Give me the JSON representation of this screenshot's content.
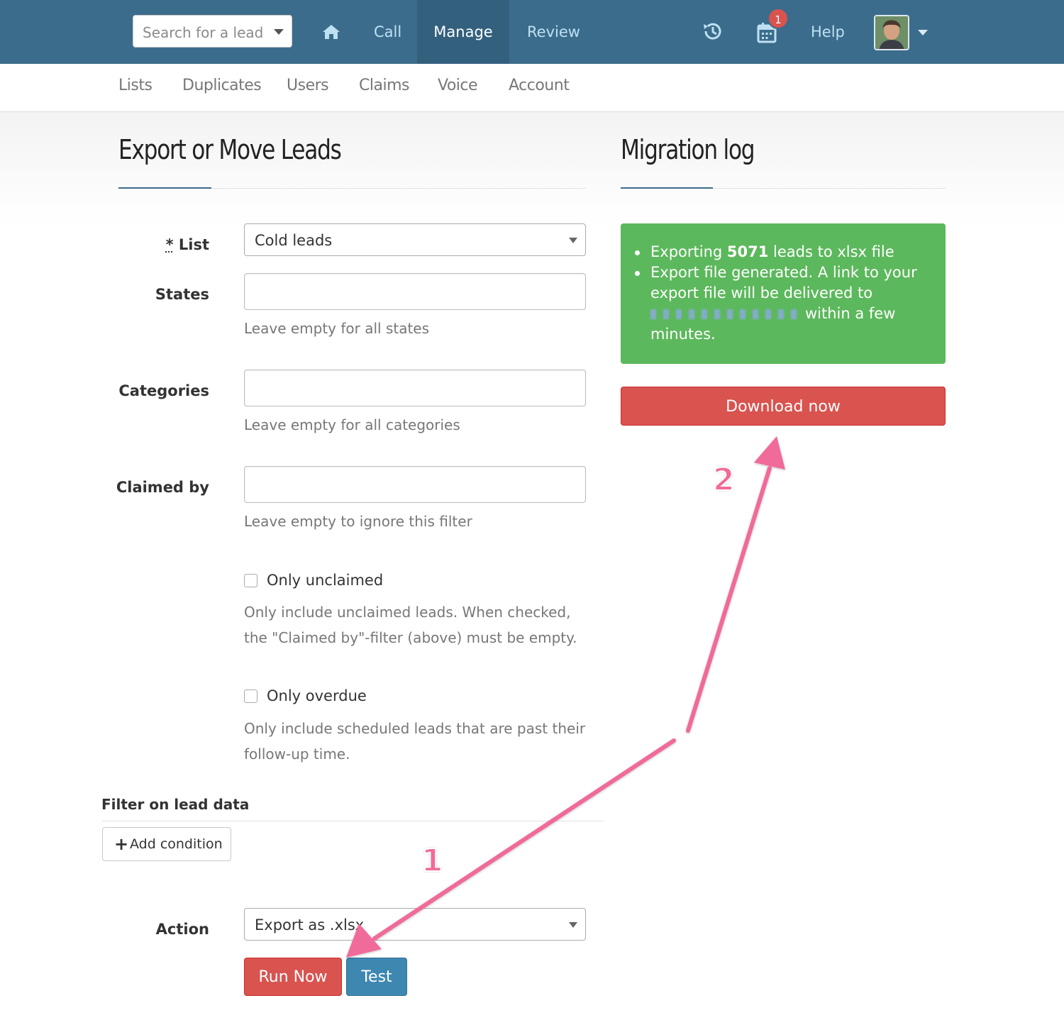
{
  "navbar": {
    "search_placeholder": "Search for a lead",
    "items": [
      {
        "label": "Call"
      },
      {
        "label": "Manage"
      },
      {
        "label": "Review"
      },
      {
        "label": "Help"
      }
    ],
    "notification_count": "1"
  },
  "subnav": {
    "items": [
      {
        "label": "Lists"
      },
      {
        "label": "Duplicates"
      },
      {
        "label": "Users"
      },
      {
        "label": "Claims"
      },
      {
        "label": "Voice"
      },
      {
        "label": "Account"
      }
    ]
  },
  "export": {
    "title": "Export or Move Leads",
    "list_label_star": "*",
    "list_label": "List",
    "list_value": "Cold leads",
    "states_label": "States",
    "states_help": "Leave empty for all states",
    "categories_label": "Categories",
    "categories_help": "Leave empty for all categories",
    "claimed_label": "Claimed by",
    "claimed_help": "Leave empty to ignore this filter",
    "only_unclaimed_label": "Only unclaimed",
    "only_unclaimed_help_1": "Only include unclaimed leads. When checked,",
    "only_unclaimed_help_2": "the \"Claimed by\"-filter (above) must be empty.",
    "only_overdue_label": "Only overdue",
    "only_overdue_help_1": "Only include scheduled leads that are past their",
    "only_overdue_help_2": "follow-up time.",
    "filter_title": "Filter on lead data",
    "add_condition": "Add condition",
    "action_label": "Action",
    "action_value": "Export as .xlsx",
    "run_now": "Run Now",
    "test": "Test"
  },
  "migration": {
    "title": "Migration log",
    "line1_prefix": "Exporting ",
    "line1_count": "5071",
    "line1_suffix": " leads to xlsx file",
    "line2_a": "Export file generated. A link to your",
    "line2_b": "export file will be delivered to",
    "line2_c": "within a few",
    "line2_d": "minutes.",
    "download": "Download now"
  },
  "annotations": {
    "step1": "1",
    "step2": "2",
    "arrow_color": "#f06b9a"
  },
  "colors": {
    "navbar": "#3b6c8c",
    "success": "#5cb85c",
    "danger": "#d9534f",
    "primary": "#3e87b0"
  }
}
